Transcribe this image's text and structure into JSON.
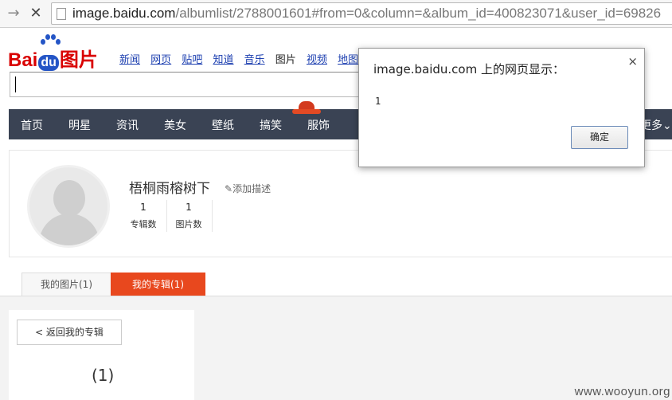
{
  "browser": {
    "back_glyph": "→",
    "close_glyph": "✕",
    "url_host": "image.baidu.com",
    "url_path": "/albumlist/2788001601#from=0&column=&album_id=400823071&user_id=69826"
  },
  "header": {
    "logo_text_1": "Bai",
    "logo_text_2": "du",
    "logo_text_3": "图片",
    "links": [
      "新闻",
      "网页",
      "贴吧",
      "知道",
      "音乐",
      "图片",
      "视频",
      "地图"
    ]
  },
  "navbar": {
    "items": [
      "首页",
      "明星",
      "资讯",
      "美女",
      "壁纸",
      "搞笑",
      "服饰",
      "更多"
    ],
    "more_suffix": "⌄"
  },
  "profile": {
    "username": "梧桐雨榕树下",
    "add_desc": "添加描述",
    "stats": [
      {
        "num": "1",
        "label": "专辑数"
      },
      {
        "num": "1",
        "label": "图片数"
      }
    ]
  },
  "tabs": [
    {
      "label": "我的图片(1)"
    },
    {
      "label": "我的专辑(1)"
    }
  ],
  "album": {
    "back_label": "< 返回我的专辑",
    "count": "(1)"
  },
  "dialog": {
    "title": "image.baidu.com 上的网页显示：",
    "close": "×",
    "message": "1",
    "ok_label": "确定"
  },
  "watermark": "www.wooyun.org",
  "colors": {
    "accent": "#e8481e",
    "nav_bg": "#3a4354",
    "logo_red": "#d90000",
    "logo_blue": "#2455c6"
  }
}
